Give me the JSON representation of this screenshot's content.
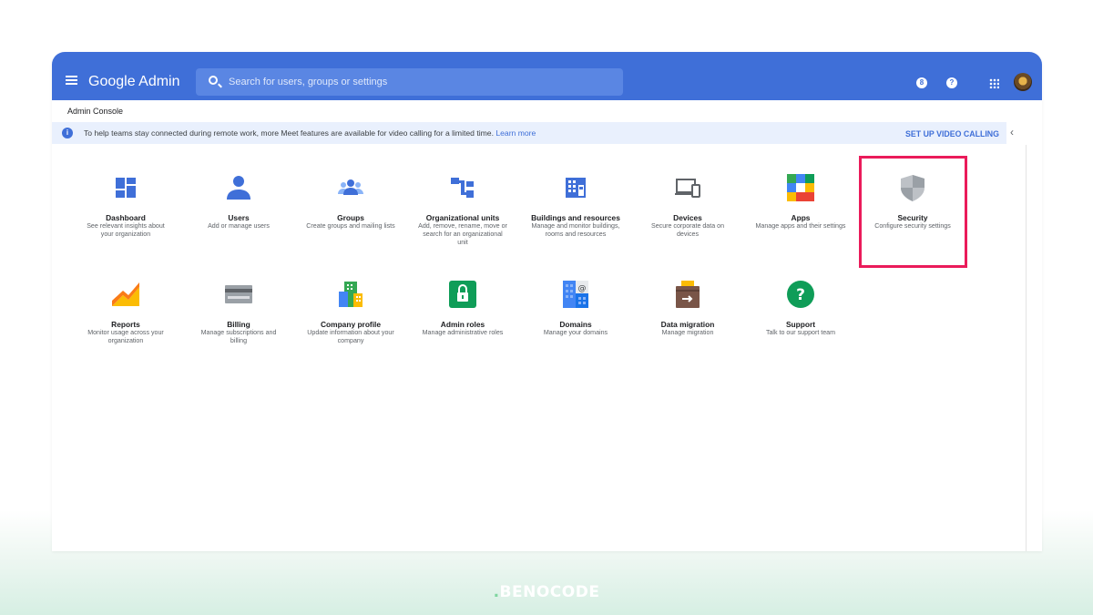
{
  "header": {
    "app_title": "Google Admin",
    "search_placeholder": "Search for users, groups or settings",
    "breadcrumb": "Admin Console",
    "help_glyph": "?",
    "account_glyph": "8"
  },
  "notice": {
    "message": "To help teams stay connected during remote work, more Meet features are available for video calling for a limited time.",
    "link": "Learn more",
    "action": "SET UP VIDEO CALLING"
  },
  "tiles_row1": [
    {
      "name": "Dashboard",
      "desc": "See relevant insights about your organization",
      "icon": "dashboard-icon"
    },
    {
      "name": "Users",
      "desc": "Add or manage users",
      "icon": "users-icon"
    },
    {
      "name": "Groups",
      "desc": "Create groups and mailing lists",
      "icon": "groups-icon"
    },
    {
      "name": "Organizational units",
      "desc": "Add, remove, rename, move or search for an organizational unit",
      "icon": "org-units-icon"
    },
    {
      "name": "Buildings and resources",
      "desc": "Manage and monitor buildings, rooms and resources",
      "icon": "buildings-icon"
    },
    {
      "name": "Devices",
      "desc": "Secure corporate data on devices",
      "icon": "devices-icon"
    },
    {
      "name": "Apps",
      "desc": "Manage apps and their settings",
      "icon": "apps-icon"
    },
    {
      "name": "Security",
      "desc": "Configure security settings",
      "icon": "shield-icon"
    }
  ],
  "tiles_row2": [
    {
      "name": "Reports",
      "desc": "Monitor usage across your organization",
      "icon": "reports-icon"
    },
    {
      "name": "Billing",
      "desc": "Manage subscriptions and billing",
      "icon": "billing-icon"
    },
    {
      "name": "Company profile",
      "desc": "Update information about your company",
      "icon": "company-profile-icon"
    },
    {
      "name": "Admin roles",
      "desc": "Manage administrative roles",
      "icon": "admin-roles-icon"
    },
    {
      "name": "Domains",
      "desc": "Manage your domains",
      "icon": "domains-icon"
    },
    {
      "name": "Data migration",
      "desc": "Manage migration",
      "icon": "data-migration-icon"
    },
    {
      "name": "Support",
      "desc": "Talk to our support team",
      "icon": "support-icon"
    }
  ],
  "watermark": "BENOCODE",
  "colors": {
    "topbar": "#3f6fd8",
    "highlight": "#ea1b5a",
    "notice_bg": "#e9f0fd"
  }
}
